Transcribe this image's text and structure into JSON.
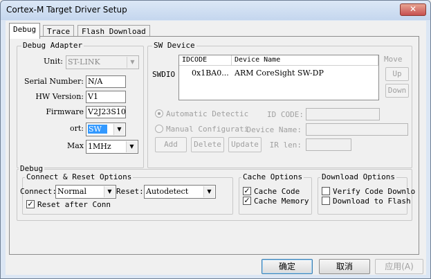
{
  "window": {
    "title": "Cortex-M Target Driver Setup",
    "close_glyph": "✕"
  },
  "tabs": [
    {
      "label": "Debug",
      "active": true
    },
    {
      "label": "Trace",
      "active": false
    },
    {
      "label": "Flash Download",
      "active": false
    }
  ],
  "debug_adapter": {
    "title": "Debug Adapter",
    "unit_label": "Unit:",
    "unit_value": "ST-LINK",
    "serial_label": "Serial Number:",
    "serial_value": "N/A",
    "hw_label": "HW Version:",
    "hw_value": "V1",
    "fw_label": "Firmware",
    "fw_value": "V2J23S10",
    "port_label": "ort:",
    "port_value": "SW",
    "max_label": "Max",
    "max_value": "1MHz"
  },
  "sw_device": {
    "title": "SW Device",
    "side_label": "SWDIO",
    "columns": [
      "IDCODE",
      "Device Name"
    ],
    "rows": [
      {
        "idcode": "0x1BA0...",
        "name": "ARM CoreSight SW-DP"
      }
    ],
    "move_label": "Move",
    "up_label": "Up",
    "down_label": "Down",
    "auto_label": "Automatic Detectic",
    "manual_label": "Manual Configurati",
    "idcode_label": "ID CODE:",
    "devname_label": "Device Name:",
    "irlen_label": "IR len:",
    "add_label": "Add",
    "delete_label": "Delete",
    "update_label": "Update"
  },
  "debug": {
    "title": "Debug",
    "connect_reset": {
      "title": "Connect & Reset Options",
      "connect_label": "Connect:",
      "connect_value": "Normal",
      "reset_label": "Reset:",
      "reset_value": "Autodetect",
      "reset_after_label": "Reset after Conn",
      "reset_after_checked": true
    },
    "cache": {
      "title": "Cache Options",
      "code_label": "Cache Code",
      "code_checked": true,
      "memory_label": "Cache Memory",
      "memory_checked": true
    },
    "download": {
      "title": "Download Options",
      "verify_label": "Verify Code Downlo",
      "verify_checked": false,
      "flash_label": "Download to Flash",
      "flash_checked": false
    }
  },
  "buttons": {
    "ok": "确定",
    "cancel": "取消",
    "apply": "应用(A)"
  },
  "colors": {
    "selection": "#3399ff",
    "close": "#c75050"
  }
}
